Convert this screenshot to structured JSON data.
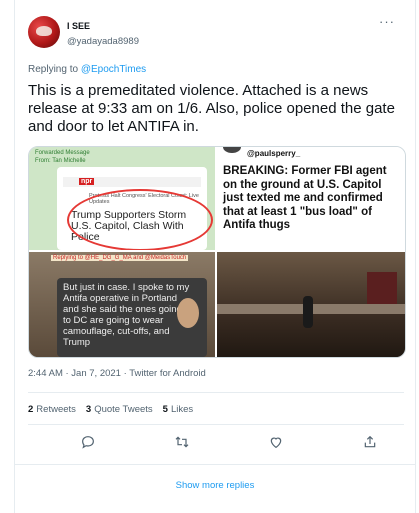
{
  "tweet": {
    "display_name": "I SEE",
    "handle": "@yadayada8989",
    "replying_prefix": "Replying to",
    "replying_to": "@EpochTimes",
    "text": "This is a premeditated violence. Attached is a news release at 9:33 am on 1/6. Also, police opened the gate and door to let ANTIFA in.",
    "timestamp": "2:44 AM · Jan 7, 2021 · Twitter for Android",
    "stats": {
      "retweets_count": "2",
      "retweets_label": "Retweets",
      "quotes_count": "3",
      "quotes_label": "Quote Tweets",
      "likes_count": "5",
      "likes_label": "Likes"
    }
  },
  "media": {
    "image1": {
      "forwarded": "Forwarded Message",
      "from": "From: Tan Michelle",
      "npr": "npr",
      "subheadline": "Protests Halt Congress' Electoral Count: Live Updates",
      "headline": "Trump Supporters Storm U.S. Capitol, Clash With Police"
    },
    "image2": {
      "user": "@paulsperry_",
      "text": "BREAKING: Former FBI agent on the ground at U.S. Capitol just texted me and confirmed that at least 1 \"bus load\" of Antifa thugs"
    },
    "image3": {
      "header": "Replying to @HE_DG_G_MA and @MeidasTouch",
      "text": "But just in case. I spoke to my Antifa operative in Portland and she said the ones going to DC are going to wear camouflage, cut-offs, and Trump"
    }
  },
  "footer": {
    "show_more": "Show more replies"
  },
  "colors": {
    "accent": "#1d9bf0",
    "secondary_text": "#536471",
    "primary_text": "#0f1419"
  },
  "icons": [
    "more-icon",
    "reply-icon",
    "retweet-icon",
    "like-icon",
    "share-icon"
  ]
}
